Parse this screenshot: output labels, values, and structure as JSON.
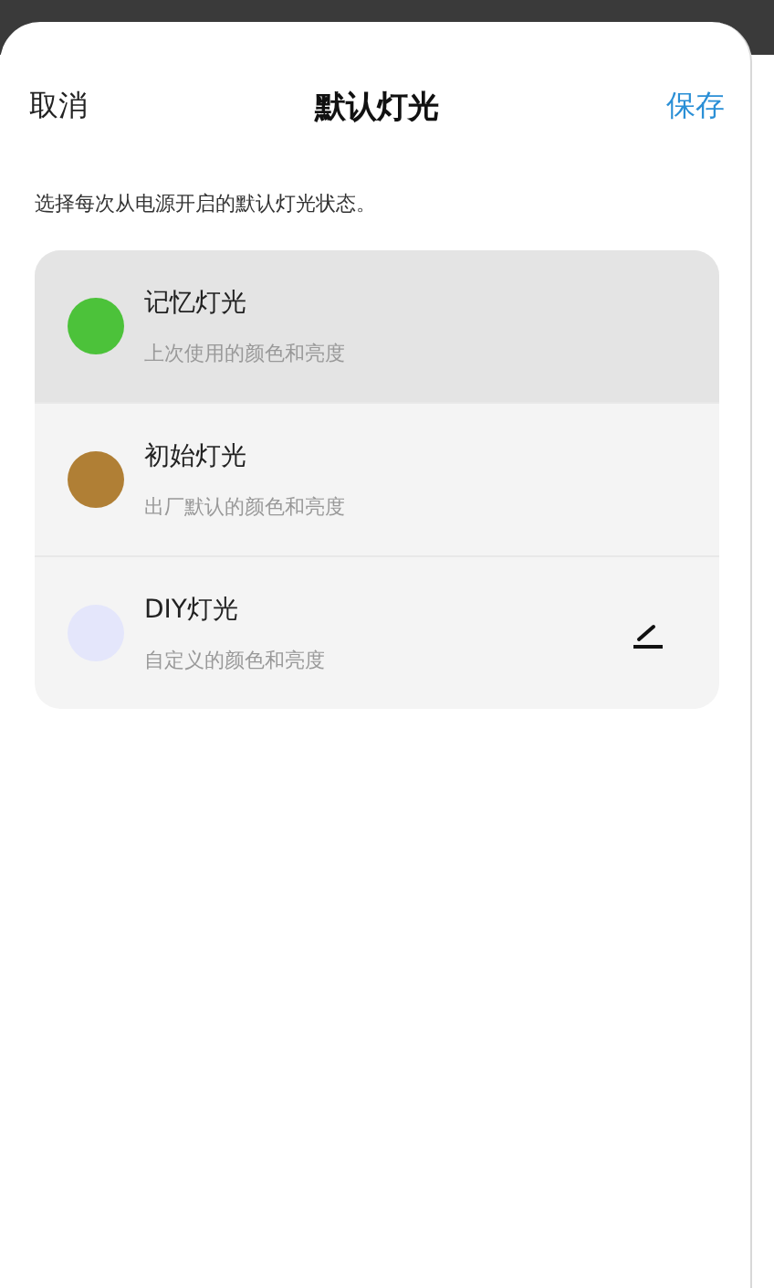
{
  "header": {
    "cancel": "取消",
    "title": "默认灯光",
    "save": "保存"
  },
  "description": "选择每次从电源开启的默认灯光状态。",
  "options": [
    {
      "title": "记忆灯光",
      "subtitle": "上次使用的颜色和亮度",
      "color": "#4cc23a",
      "selected": true,
      "editable": false
    },
    {
      "title": "初始灯光",
      "subtitle": "出厂默认的颜色和亮度",
      "color": "#b07f35",
      "selected": false,
      "editable": false
    },
    {
      "title": "DIY灯光",
      "subtitle": "自定义的颜色和亮度",
      "color": "#e4e6fb",
      "selected": false,
      "editable": true
    }
  ]
}
